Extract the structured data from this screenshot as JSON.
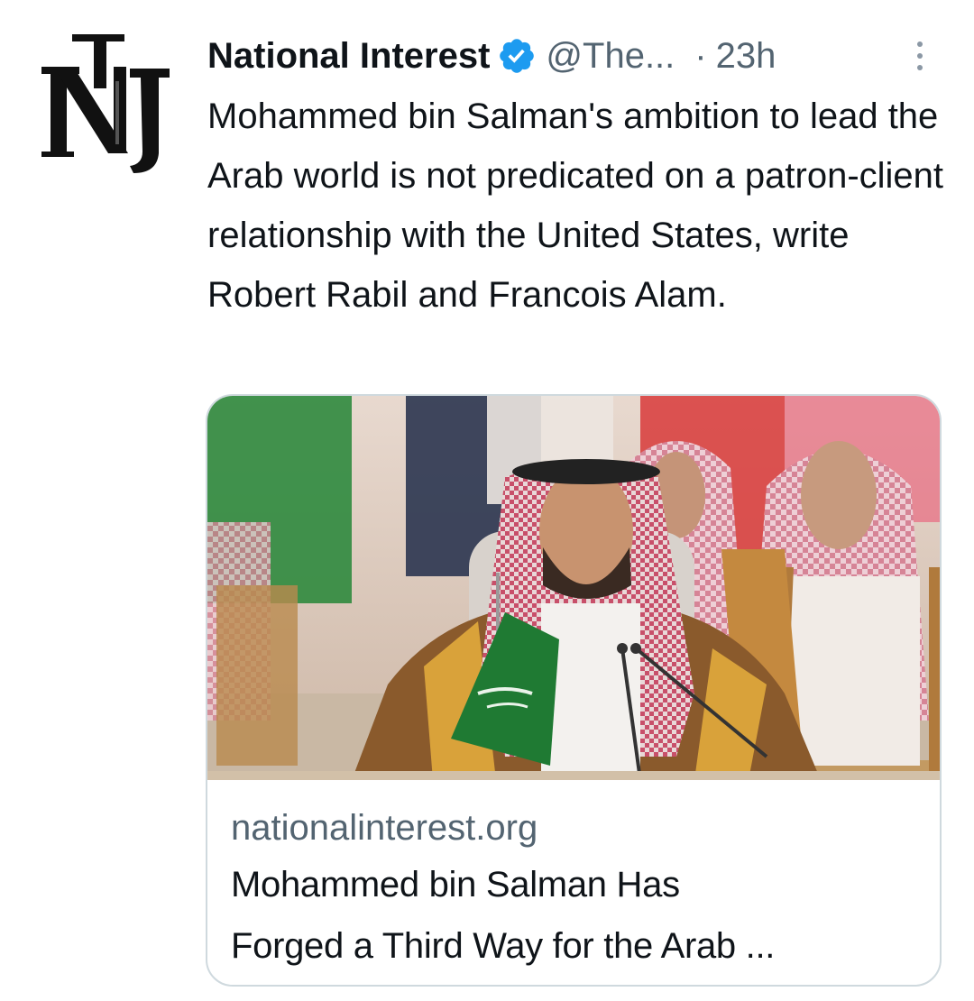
{
  "tweet": {
    "display_name": "National Interest",
    "verified_icon": "verified-badge-icon",
    "handle": "@The...",
    "separator": "·",
    "time": "23h",
    "more_icon": "more-vertical-icon",
    "avatar_text": "NI",
    "text": "Mohammed bin Salman's ambition to lead the Arab world is not predicated on a patron-client relationship with the United States, write Robert Rabil and Francois Alam."
  },
  "card": {
    "domain": "nationalinterest.org",
    "title_line1": "Mohammed bin Salman Has",
    "title_line2": "Forged a Third Way for the Arab ..."
  },
  "colors": {
    "text_primary": "#0f1419",
    "text_secondary": "#536471",
    "verified_blue": "#1d9bf0",
    "card_border": "#cfd9de"
  }
}
